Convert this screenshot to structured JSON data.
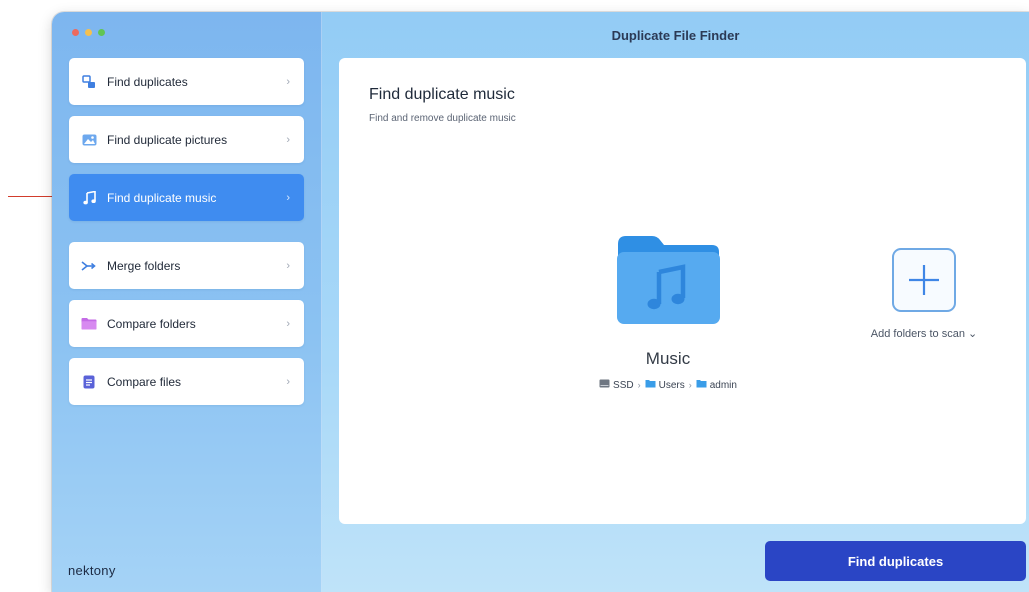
{
  "window": {
    "title": "Duplicate File Finder"
  },
  "sidebar": {
    "items": [
      {
        "label": "Find duplicates",
        "chevron": "›",
        "icon": "duplicates-icon"
      },
      {
        "label": "Find duplicate pictures",
        "chevron": "›",
        "icon": "pictures-icon"
      },
      {
        "label": "Find duplicate music",
        "chevron": "›",
        "icon": "music-note-icon",
        "active": true
      },
      {
        "label": "Merge folders",
        "chevron": "›",
        "icon": "merge-icon"
      },
      {
        "label": "Compare folders",
        "chevron": "›",
        "icon": "folder-icon"
      },
      {
        "label": "Compare files",
        "chevron": "›",
        "icon": "document-icon"
      }
    ],
    "brand": "nektony"
  },
  "main": {
    "title": "Find duplicate music",
    "subtitle": "Find and remove duplicate music",
    "folder": {
      "name": "Music",
      "path": [
        "SSD",
        "Users",
        "admin"
      ],
      "path_separator": "›"
    },
    "add": {
      "label": "Add folders to scan ⌄"
    },
    "find_button": "Find duplicates"
  },
  "colors": {
    "accent": "#3f8cf0",
    "find_button": "#2a45c5",
    "annotation_arrow": "#d23c2c",
    "folder": "#56aaf0"
  }
}
